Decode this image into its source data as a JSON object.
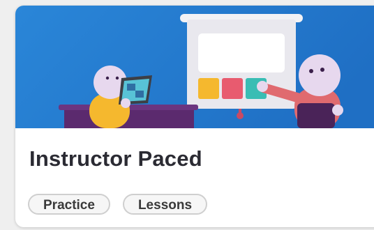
{
  "card": {
    "title": "Instructor Paced",
    "tags": [
      {
        "label": "Practice"
      },
      {
        "label": "Lessons"
      }
    ],
    "illustration": {
      "icon": "classroom-illustration",
      "background_color": "#2a86d8"
    }
  }
}
